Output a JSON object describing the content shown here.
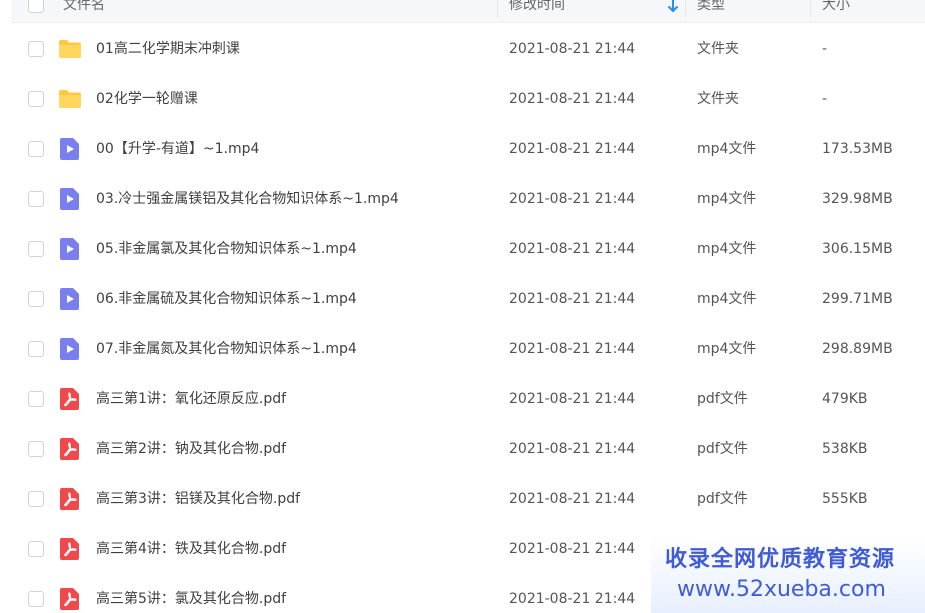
{
  "header": {
    "name_label": "文件名",
    "mtime_label": "修改时间",
    "type_label": "类型",
    "size_label": "大小"
  },
  "files": [
    {
      "icon": "folder-icon",
      "name": "01高二化学期末冲刺课",
      "mtime": "2021-08-21 21:44",
      "type": "文件夹",
      "size": "-"
    },
    {
      "icon": "folder-icon",
      "name": "02化学一轮赠课",
      "mtime": "2021-08-21 21:44",
      "type": "文件夹",
      "size": "-"
    },
    {
      "icon": "video-icon",
      "name": "00【升学-有道】~1.mp4",
      "mtime": "2021-08-21 21:44",
      "type": "mp4文件",
      "size": "173.53MB"
    },
    {
      "icon": "video-icon",
      "name": "03.冷士强金属镁铝及其化合物知识体系~1.mp4",
      "mtime": "2021-08-21 21:44",
      "type": "mp4文件",
      "size": "329.98MB"
    },
    {
      "icon": "video-icon",
      "name": "05.非金属氯及其化合物知识体系~1.mp4",
      "mtime": "2021-08-21 21:44",
      "type": "mp4文件",
      "size": "306.15MB"
    },
    {
      "icon": "video-icon",
      "name": "06.非金属硫及其化合物知识体系~1.mp4",
      "mtime": "2021-08-21 21:44",
      "type": "mp4文件",
      "size": "299.71MB"
    },
    {
      "icon": "video-icon",
      "name": "07.非金属氮及其化合物知识体系~1.mp4",
      "mtime": "2021-08-21 21:44",
      "type": "mp4文件",
      "size": "298.89MB"
    },
    {
      "icon": "pdf-icon",
      "name": "高三第1讲：氧化还原反应.pdf",
      "mtime": "2021-08-21 21:44",
      "type": "pdf文件",
      "size": "479KB"
    },
    {
      "icon": "pdf-icon",
      "name": "高三第2讲：钠及其化合物.pdf",
      "mtime": "2021-08-21 21:44",
      "type": "pdf文件",
      "size": "538KB"
    },
    {
      "icon": "pdf-icon",
      "name": "高三第3讲：铝镁及其化合物.pdf",
      "mtime": "2021-08-21 21:44",
      "type": "pdf文件",
      "size": "555KB"
    },
    {
      "icon": "pdf-icon",
      "name": "高三第4讲：铁及其化合物.pdf",
      "mtime": "2021-08-21 21:44",
      "type": "",
      "size": ""
    },
    {
      "icon": "pdf-icon",
      "name": "高三第5讲：氯及其化合物.pdf",
      "mtime": "2021-08-21 21:44",
      "type": "",
      "size": ""
    }
  ],
  "watermark": {
    "line1": "收录全网优质教育资源",
    "line2": "www.52xueba.com"
  },
  "colors": {
    "folder": "#ffc93f",
    "video": "#7a7ff0",
    "pdf": "#f0484b",
    "sort_arrow": "#2a8cf5",
    "watermark_text": "#3f5bd6"
  }
}
